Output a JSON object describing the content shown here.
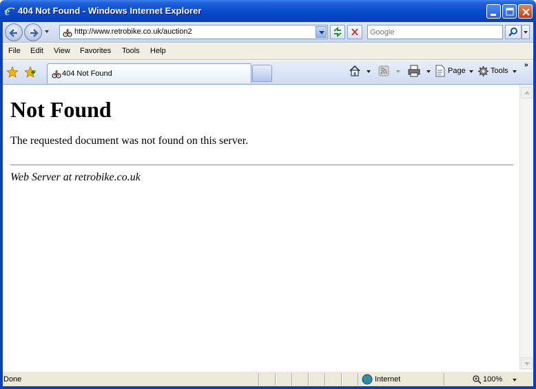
{
  "window": {
    "title": "404 Not Found - Windows Internet Explorer",
    "colors": {
      "titlebar": "#0a4fd0",
      "frame": "#0840c0",
      "close_button": "#c4391b"
    }
  },
  "toolbar": {
    "back_icon": "back-arrow-icon",
    "forward_icon": "forward-arrow-icon",
    "address_url": "http://www.retrobike.co.uk/auction2",
    "search_placeholder": "Google"
  },
  "menu": {
    "items": [
      "File",
      "Edit",
      "View",
      "Favorites",
      "Tools",
      "Help"
    ]
  },
  "tabs": [
    {
      "label": "404 Not Found",
      "active": true
    }
  ],
  "commands": {
    "page_label": "Page",
    "tools_label": "Tools",
    "more_label": "»"
  },
  "content": {
    "heading": "Not Found",
    "message": "The requested document was not found on this server.",
    "address": "Web Server at retrobike.co.uk"
  },
  "status": {
    "text": "Done",
    "zone": "Internet",
    "zoom": "100%"
  }
}
